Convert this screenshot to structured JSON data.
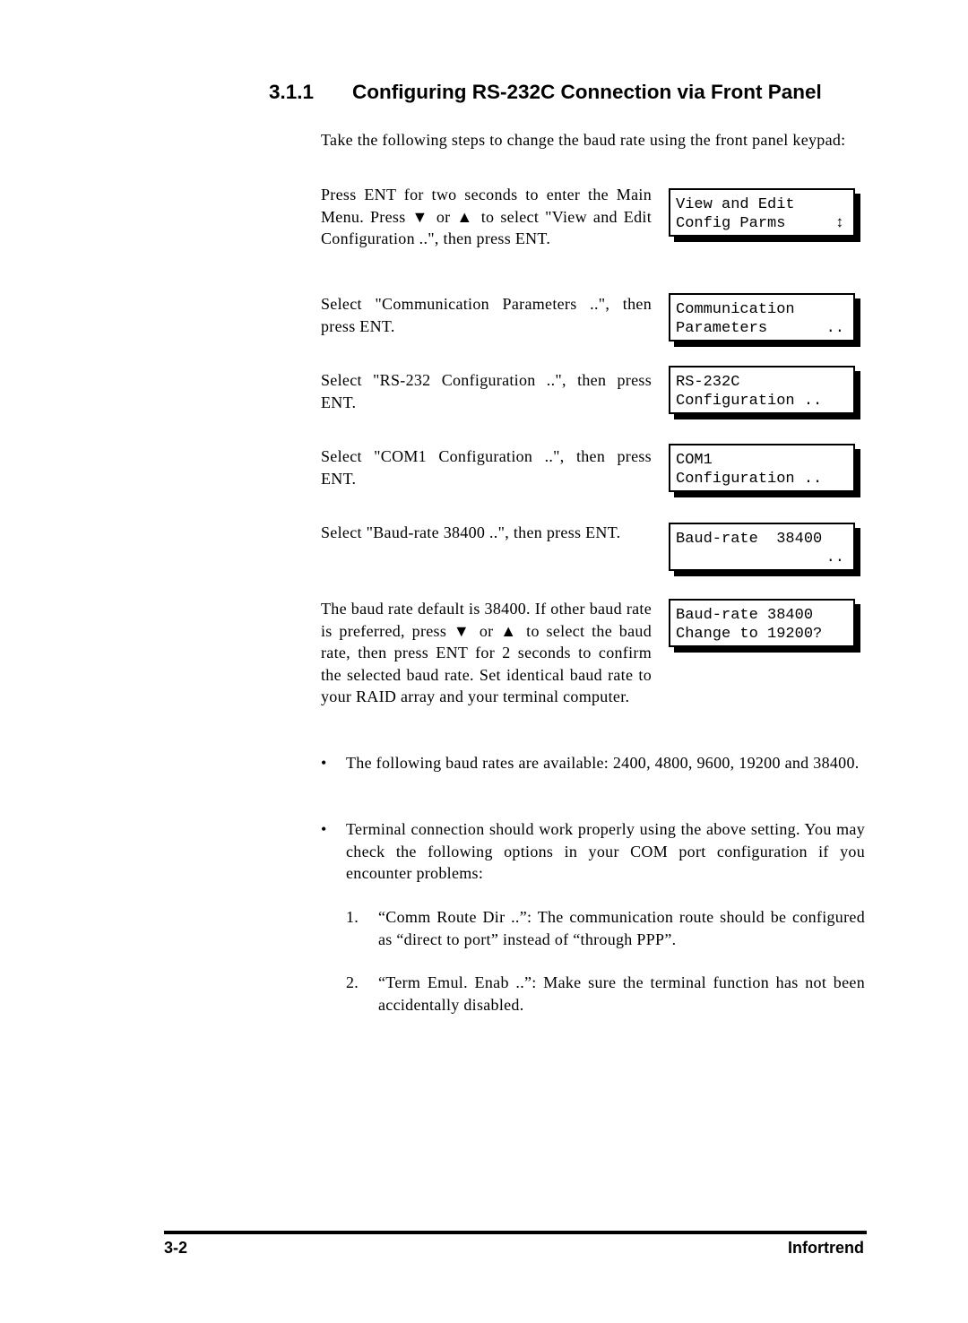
{
  "section": {
    "number": "3.1.1",
    "title": "Configuring RS-232C Connection via Front Panel"
  },
  "intro": "Take the following steps to change the baud rate using the front panel keypad:",
  "steps": [
    {
      "text": "Press ENT for two seconds to enter the Main Menu.  Press ▼ or ▲ to select \"View and Edit Configuration ..\", then press ENT.",
      "lcd": [
        [
          "View and Edit",
          ""
        ],
        [
          "Config Parms",
          "↕"
        ]
      ]
    },
    {
      "text": "Select \"Communication Parameters ..\", then press ENT.",
      "lcd": [
        [
          "Communication",
          ""
        ],
        [
          "Parameters",
          ".."
        ]
      ]
    },
    {
      "text": "Select \"RS-232 Configuration ..\", then press ENT.",
      "lcd": [
        [
          "RS-232C",
          ""
        ],
        [
          "Configuration ..",
          ""
        ]
      ]
    },
    {
      "text": "Select \"COM1 Configuration ..\", then press ENT.",
      "lcd": [
        [
          "COM1",
          ""
        ],
        [
          "Configuration ..",
          ""
        ]
      ]
    },
    {
      "text": "Select \"Baud-rate 38400 ..\", then press ENT.",
      "lcd": [
        [
          "Baud-rate  38400",
          ""
        ],
        [
          "",
          ".."
        ]
      ]
    },
    {
      "text": "The baud rate default is 38400.  If other baud rate is preferred, press ▼ or ▲ to select the baud rate, then press ENT for 2 seconds to confirm the selected baud rate.  Set identical baud rate to your RAID array and your terminal computer.",
      "lcd": [
        [
          "Baud-rate 38400",
          ""
        ],
        [
          "Change to 19200?",
          ""
        ]
      ]
    }
  ],
  "bullets": [
    "The following baud rates are available: 2400, 4800, 9600, 19200 and 38400.",
    "Terminal connection should work properly using the above setting.  You may check the following options in your COM port configuration if you encounter problems:"
  ],
  "bullet_symbol": "•",
  "numbered": [
    {
      "n": "1.",
      "text": "“Comm Route Dir ..”: The communication route should be configured as “direct to port” instead of “through PPP”."
    },
    {
      "n": "2.",
      "text": "“Term Emul. Enab ..”: Make sure the terminal function has not been accidentally disabled."
    }
  ],
  "footer": {
    "page": "3-2",
    "brand": "Infortrend"
  }
}
